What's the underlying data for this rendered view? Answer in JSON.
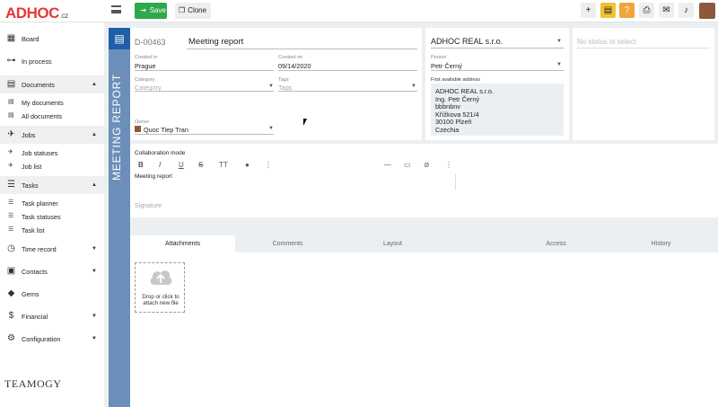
{
  "app": {
    "logo_ad": "AD",
    "logo_hoc": "HOC",
    "logo_tld": ".cz",
    "footer_logo": "TEAMOGY"
  },
  "toolbar": {
    "save_label": "Save",
    "clone_label": "Clone",
    "icons": [
      "plus-icon",
      "note-icon",
      "help-icon",
      "print-icon",
      "chat-icon",
      "bell-icon"
    ]
  },
  "sidebar": {
    "items": [
      {
        "label": "Board",
        "icon": "grid-icon"
      },
      {
        "label": "In process",
        "icon": "flow-icon"
      },
      {
        "label": "Documents",
        "icon": "document-icon",
        "caret": "▲"
      },
      {
        "label": "My documents",
        "icon": "doc-small-icon"
      },
      {
        "label": "All documents",
        "icon": "doc-small-icon"
      },
      {
        "label": "Jobs",
        "icon": "rocket-icon",
        "caret": "▲"
      },
      {
        "label": "Job statuses",
        "icon": "rocket-small-icon"
      },
      {
        "label": "Job list",
        "icon": "rocket-small-icon"
      },
      {
        "label": "Tasks",
        "icon": "tasks-icon",
        "caret": "▲"
      },
      {
        "label": "Task planner",
        "icon": "list-icon"
      },
      {
        "label": "Task statuses",
        "icon": "list-icon"
      },
      {
        "label": "Task list",
        "icon": "list-icon"
      },
      {
        "label": "Time record",
        "icon": "clock-icon",
        "caret": "▼"
      },
      {
        "label": "Contacts",
        "icon": "contacts-icon",
        "caret": "▼"
      },
      {
        "label": "Gems",
        "icon": "gem-icon"
      },
      {
        "label": "Financial",
        "icon": "dollar-icon",
        "caret": "▼"
      },
      {
        "label": "Configuration",
        "icon": "gear-icon",
        "caret": "▼"
      }
    ]
  },
  "document": {
    "strip_text": "MEETING REPORT",
    "id": "D-00463",
    "title": "Meeting report",
    "created_in_label": "Created in",
    "created_in": "Prague",
    "created_on_label": "Created on",
    "created_on": "09/14/2020",
    "category_label": "Category",
    "category_placeholder": "Category",
    "tags_label": "Tags",
    "tags_placeholder": "Tags",
    "owner_label": "Owner",
    "owner": "Quoc Tiep Tran"
  },
  "company": {
    "name": "ADHOC REAL s.r.o.",
    "person_label": "Person",
    "person": "Petr Černý",
    "address_label": "First available address",
    "address_lines": [
      "ADHOC REAL s.r.o.",
      "Ing. Petr Černý",
      "bbbnbnv",
      "Křížkova 521/4",
      "30100 Plzeň",
      "Czechia"
    ]
  },
  "status": {
    "placeholder": "No status to select"
  },
  "editor": {
    "mode_label": "Collaboration mode",
    "content": "Meeting report",
    "signature_placeholder": "Signature",
    "toolbar_icons": [
      "bold-icon",
      "italic-icon",
      "underline-icon",
      "strikethrough-icon",
      "text-size-icon",
      "color-drop-icon",
      "more-vert-icon",
      "horizontal-rule-icon",
      "image-icon",
      "link-icon",
      "more-vert-icon"
    ],
    "toolbar_glyphs": [
      "B",
      "I",
      "U",
      "S",
      "TT",
      "●",
      "⋮",
      "—",
      "▭",
      "⊘",
      "⋮"
    ]
  },
  "tabs": [
    {
      "label": "Attachments",
      "active": true
    },
    {
      "label": "Comments",
      "active": false
    },
    {
      "label": "Layout",
      "active": false
    },
    {
      "label": "Access",
      "active": false
    },
    {
      "label": "History",
      "active": false
    }
  ],
  "attachments": {
    "drop_text_1": "Drop or click to",
    "drop_text_2": "attach new file"
  }
}
